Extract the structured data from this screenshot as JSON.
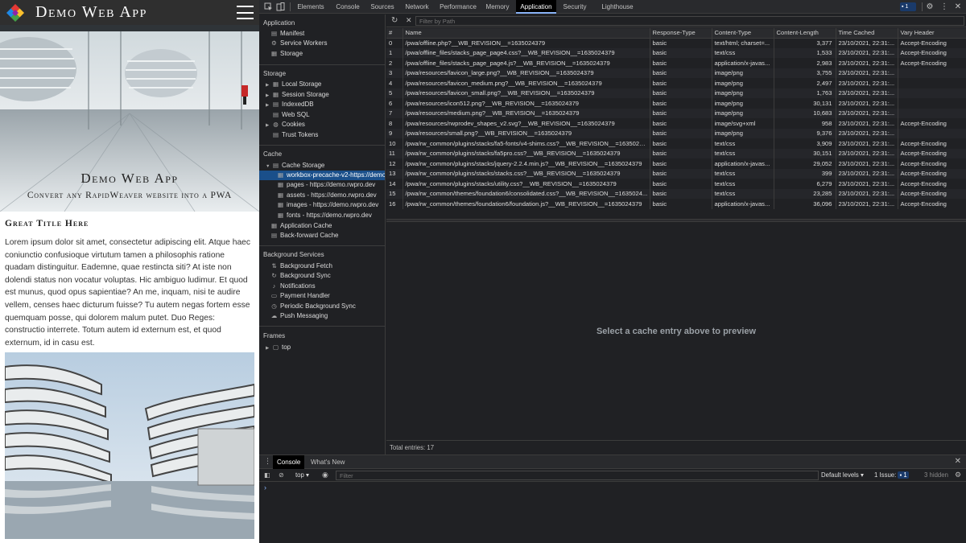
{
  "webpage": {
    "brand": "Demo Web App",
    "hero_title": "Demo Web App",
    "hero_subtitle": "Convert any RapidWeaver website into a PWA",
    "section_title": "Great Title Here",
    "body_text": "Lorem ipsum dolor sit amet, consectetur adipiscing elit. Atque haec coniunctio confusioque virtutum tamen a philosophis ratione quadam distinguitur. Eademne, quae restincta siti? At iste non dolendi status non vocatur voluptas. Hic ambiguo ludimur. Et quod est munus, quod opus sapientiae? An me, inquam, nisi te audire vellem, censes haec dicturum fuisse? Tu autem negas fortem esse quemquam posse, qui dolorem malum putet. Duo Reges: constructio interrete. Totum autem id externum est, et quod externum, id in casu est."
  },
  "devtools": {
    "tabs": [
      "Elements",
      "Console",
      "Sources",
      "Network",
      "Performance",
      "Memory",
      "Application",
      "Security",
      "Lighthouse"
    ],
    "active_tab": "Application",
    "issues_badge": "1",
    "sidebar": {
      "application_header": "Application",
      "application_items": [
        {
          "label": "Manifest",
          "icon": "document-icon"
        },
        {
          "label": "Service Workers",
          "icon": "gear-icon"
        },
        {
          "label": "Storage",
          "icon": "database-icon"
        }
      ],
      "storage_header": "Storage",
      "storage_items": [
        {
          "label": "Local Storage",
          "icon": "grid-icon"
        },
        {
          "label": "Session Storage",
          "icon": "grid-icon"
        },
        {
          "label": "IndexedDB",
          "icon": "database-icon"
        },
        {
          "label": "Web SQL",
          "icon": "database-icon"
        },
        {
          "label": "Cookies",
          "icon": "cookie-icon"
        },
        {
          "label": "Trust Tokens",
          "icon": "database-icon"
        }
      ],
      "cache_header": "Cache",
      "cache_storage": "Cache Storage",
      "cache_children": [
        "workbox-precache-v2-https://demo.",
        "pages - https://demo.rwpro.dev",
        "assets - https://demo.rwpro.dev",
        "images - https://demo.rwpro.dev",
        "fonts - https://demo.rwpro.dev"
      ],
      "cache_other": [
        "Application Cache",
        "Back-forward Cache"
      ],
      "bg_header": "Background Services",
      "bg_items": [
        {
          "label": "Background Fetch",
          "icon": "arrows-icon"
        },
        {
          "label": "Background Sync",
          "icon": "sync-icon"
        },
        {
          "label": "Notifications",
          "icon": "bell-icon"
        },
        {
          "label": "Payment Handler",
          "icon": "card-icon"
        },
        {
          "label": "Periodic Background Sync",
          "icon": "clock-icon"
        },
        {
          "label": "Push Messaging",
          "icon": "cloud-icon"
        }
      ],
      "frames_header": "Frames",
      "frames_top": "top"
    },
    "filter_placeholder": "Filter by Path",
    "table": {
      "columns": [
        "#",
        "Name",
        "Response-Type",
        "Content-Type",
        "Content-Length",
        "Time Cached",
        "Vary Header"
      ],
      "rows": [
        [
          "0",
          "/pwa/offline.php?__WB_REVISION__=1635024379",
          "basic",
          "text/html; charset=...",
          "3,377",
          "23/10/2021, 22:31:...",
          "Accept-Encoding"
        ],
        [
          "1",
          "/pwa/offline_files/stacks_page_page4.css?__WB_REVISION__=1635024379",
          "basic",
          "text/css",
          "1,533",
          "23/10/2021, 22:31:...",
          "Accept-Encoding"
        ],
        [
          "2",
          "/pwa/offline_files/stacks_page_page4.js?__WB_REVISION__=1635024379",
          "basic",
          "application/x-javas...",
          "2,983",
          "23/10/2021, 22:31:...",
          "Accept-Encoding"
        ],
        [
          "3",
          "/pwa/resources/favicon_large.png?__WB_REVISION__=1635024379",
          "basic",
          "image/png",
          "3,755",
          "23/10/2021, 22:31:...",
          ""
        ],
        [
          "4",
          "/pwa/resources/favicon_medium.png?__WB_REVISION__=1635024379",
          "basic",
          "image/png",
          "2,497",
          "23/10/2021, 22:31:...",
          ""
        ],
        [
          "5",
          "/pwa/resources/favicon_small.png?__WB_REVISION__=1635024379",
          "basic",
          "image/png",
          "1,763",
          "23/10/2021, 22:31:...",
          ""
        ],
        [
          "6",
          "/pwa/resources/icon512.png?__WB_REVISION__=1635024379",
          "basic",
          "image/png",
          "30,131",
          "23/10/2021, 22:31:...",
          ""
        ],
        [
          "7",
          "/pwa/resources/medium.png?__WB_REVISION__=1635024379",
          "basic",
          "image/png",
          "10,683",
          "23/10/2021, 22:31:...",
          ""
        ],
        [
          "8",
          "/pwa/resources/rwprodev_shapes_v2.svg?__WB_REVISION__=1635024379",
          "basic",
          "image/svg+xml",
          "958",
          "23/10/2021, 22:31:...",
          "Accept-Encoding"
        ],
        [
          "9",
          "/pwa/resources/small.png?__WB_REVISION__=1635024379",
          "basic",
          "image/png",
          "9,376",
          "23/10/2021, 22:31:...",
          ""
        ],
        [
          "10",
          "/pwa/rw_common/plugins/stacks/fa5-fonts/v4-shims.css?__WB_REVISION__=1635024...",
          "basic",
          "text/css",
          "3,909",
          "23/10/2021, 22:31:...",
          "Accept-Encoding"
        ],
        [
          "11",
          "/pwa/rw_common/plugins/stacks/fa5pro.css?__WB_REVISION__=1635024379",
          "basic",
          "text/css",
          "30,151",
          "23/10/2021, 22:31:...",
          "Accept-Encoding"
        ],
        [
          "12",
          "/pwa/rw_common/plugins/stacks/jquery-2.2.4.min.js?__WB_REVISION__=1635024379",
          "basic",
          "application/x-javas...",
          "29,052",
          "23/10/2021, 22:31:...",
          "Accept-Encoding"
        ],
        [
          "13",
          "/pwa/rw_common/plugins/stacks/stacks.css?__WB_REVISION__=1635024379",
          "basic",
          "text/css",
          "399",
          "23/10/2021, 22:31:...",
          "Accept-Encoding"
        ],
        [
          "14",
          "/pwa/rw_common/plugins/stacks/utility.css?__WB_REVISION__=1635024379",
          "basic",
          "text/css",
          "6,279",
          "23/10/2021, 22:31:...",
          "Accept-Encoding"
        ],
        [
          "15",
          "/pwa/rw_common/themes/foundation6/consolidated.css?__WB_REVISION__=1635024...",
          "basic",
          "text/css",
          "23,285",
          "23/10/2021, 22:31:...",
          "Accept-Encoding"
        ],
        [
          "16",
          "/pwa/rw_common/themes/foundation6/foundation.js?__WB_REVISION__=1635024379",
          "basic",
          "application/x-javas...",
          "36,096",
          "23/10/2021, 22:31:...",
          "Accept-Encoding"
        ]
      ]
    },
    "preview_message": "Select a cache entry above to preview",
    "total_entries": "Total entries: 17",
    "drawer": {
      "tabs": [
        "Console",
        "What's New"
      ],
      "context": "top",
      "filter_placeholder": "Filter",
      "levels": "Default levels",
      "issue_label": "1 Issue:",
      "issue_count": "1",
      "hidden": "3 hidden",
      "prompt": "›"
    },
    "colors": {
      "accent": "#8ab4f8",
      "selected": "#1a4f8a",
      "background": "#202124"
    }
  }
}
